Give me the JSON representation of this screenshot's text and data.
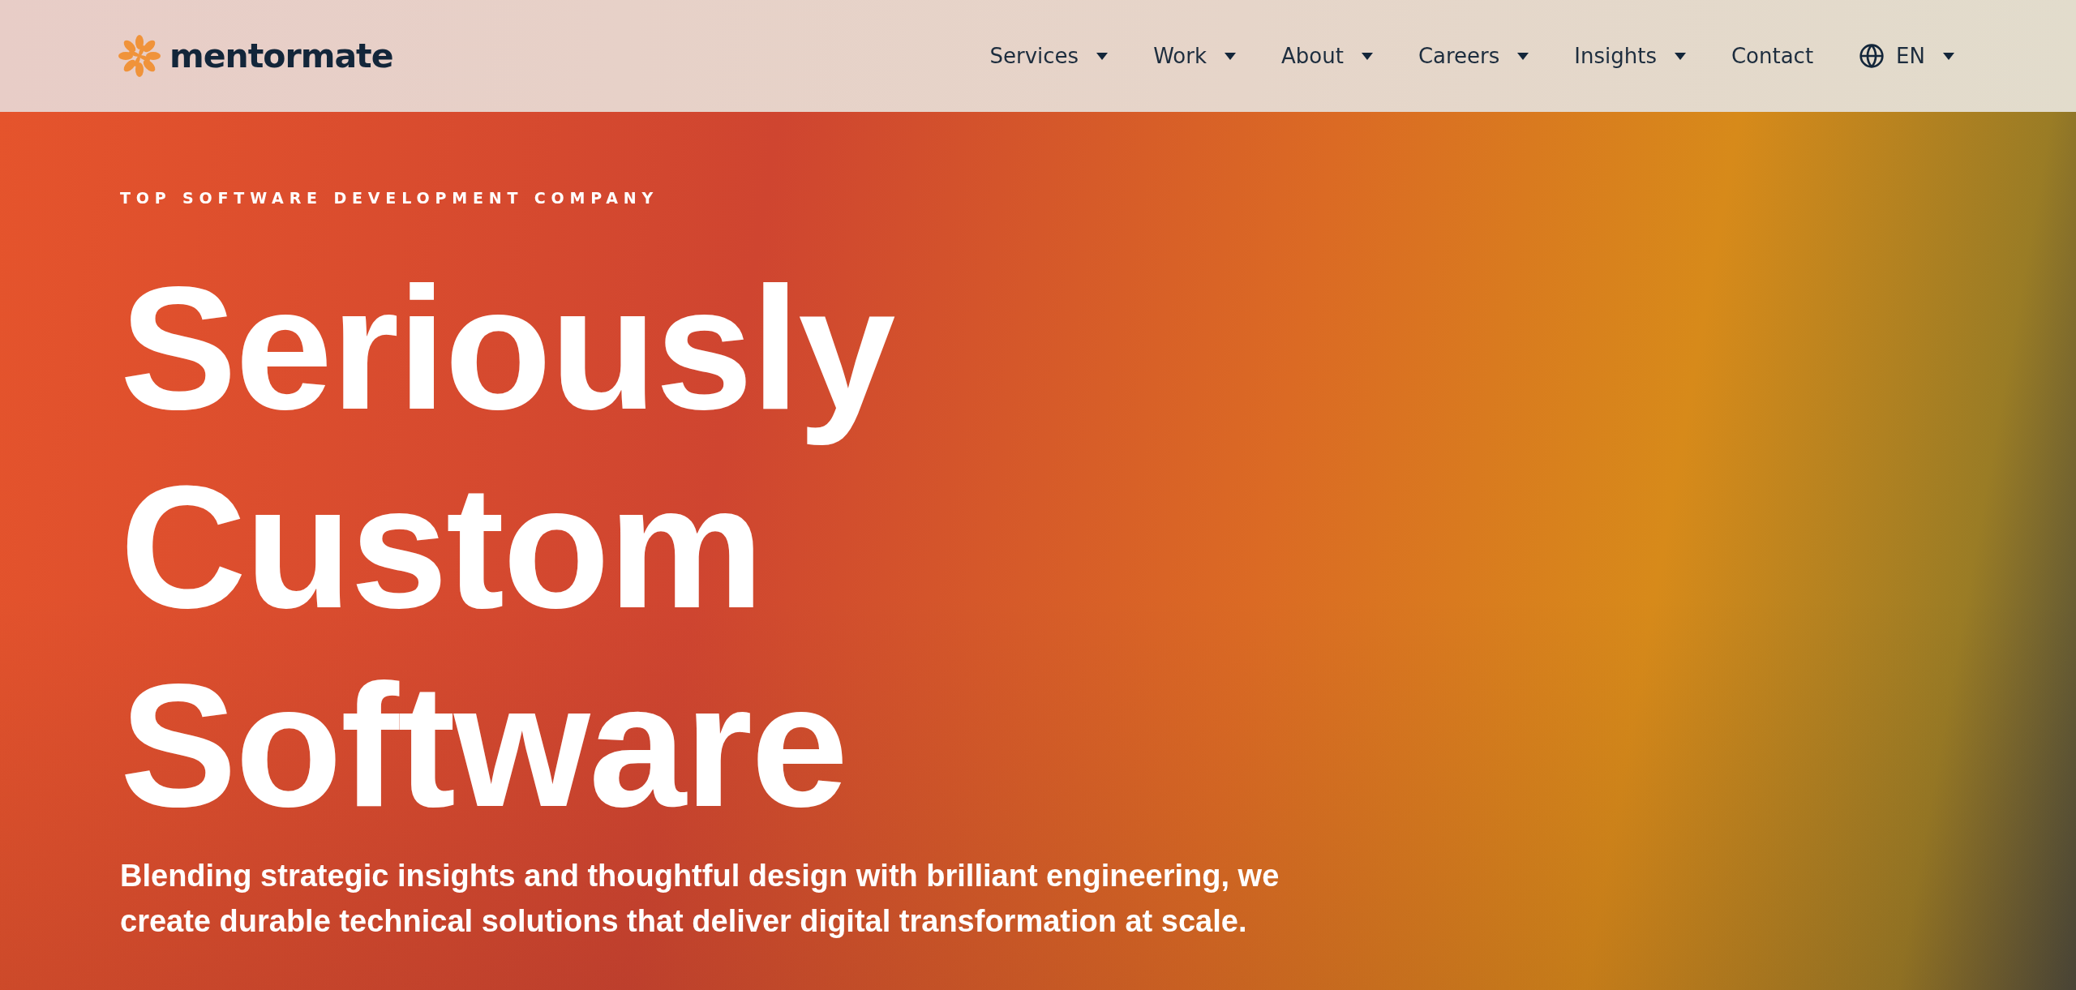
{
  "header": {
    "logo": "mentormate",
    "nav": [
      {
        "label": "Services",
        "dropdown": true
      },
      {
        "label": "Work",
        "dropdown": true
      },
      {
        "label": "About",
        "dropdown": true
      },
      {
        "label": "Careers",
        "dropdown": true
      },
      {
        "label": "Insights",
        "dropdown": true
      },
      {
        "label": "Contact",
        "dropdown": false
      }
    ],
    "language": "EN"
  },
  "hero": {
    "eyebrow": "TOP SOFTWARE DEVELOPMENT COMPANY",
    "headline": [
      "Seriously",
      "Custom",
      "Software"
    ],
    "subtitle": "Blending strategic insights and thoughtful design with brilliant engineering, we create durable technical solutions that deliver digital transformation at scale."
  }
}
